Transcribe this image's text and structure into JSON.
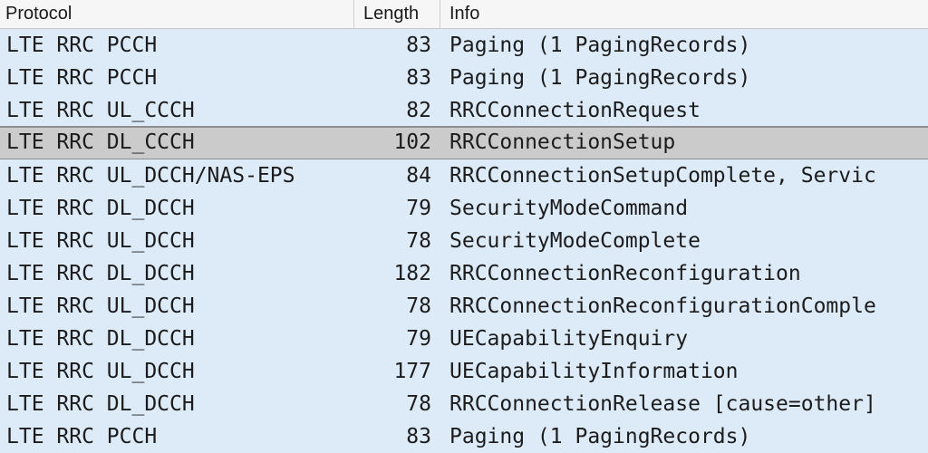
{
  "columns": {
    "protocol": "Protocol",
    "length": "Length",
    "info": "Info"
  },
  "rows": [
    {
      "protocol": "LTE RRC PCCH",
      "length": "83",
      "info": "Paging (1 PagingRecords)"
    },
    {
      "protocol": "LTE RRC PCCH",
      "length": "83",
      "info": "Paging (1 PagingRecords)"
    },
    {
      "protocol": "LTE RRC UL_CCCH",
      "length": "82",
      "info": "RRCConnectionRequest"
    },
    {
      "protocol": "LTE RRC DL_CCCH",
      "length": "102",
      "info": "RRCConnectionSetup",
      "selected": true
    },
    {
      "protocol": "LTE RRC UL_DCCH/NAS-EPS",
      "length": "84",
      "info": "RRCConnectionSetupComplete, Servic"
    },
    {
      "protocol": "LTE RRC DL_DCCH",
      "length": "79",
      "info": "SecurityModeCommand"
    },
    {
      "protocol": "LTE RRC UL_DCCH",
      "length": "78",
      "info": "SecurityModeComplete"
    },
    {
      "protocol": "LTE RRC DL_DCCH",
      "length": "182",
      "info": "RRCConnectionReconfiguration"
    },
    {
      "protocol": "LTE RRC UL_DCCH",
      "length": "78",
      "info": "RRCConnectionReconfigurationComple"
    },
    {
      "protocol": "LTE RRC DL_DCCH",
      "length": "79",
      "info": "UECapabilityEnquiry"
    },
    {
      "protocol": "LTE RRC UL_DCCH",
      "length": "177",
      "info": "UECapabilityInformation"
    },
    {
      "protocol": "LTE RRC DL_DCCH",
      "length": "78",
      "info": "RRCConnectionRelease [cause=other]"
    },
    {
      "protocol": "LTE RRC PCCH",
      "length": "83",
      "info": "Paging (1 PagingRecords)"
    }
  ],
  "colors": {
    "row_background": "#ddebf9",
    "selected_background": "#cbcbcb",
    "header_background": "#f6f6f6"
  }
}
